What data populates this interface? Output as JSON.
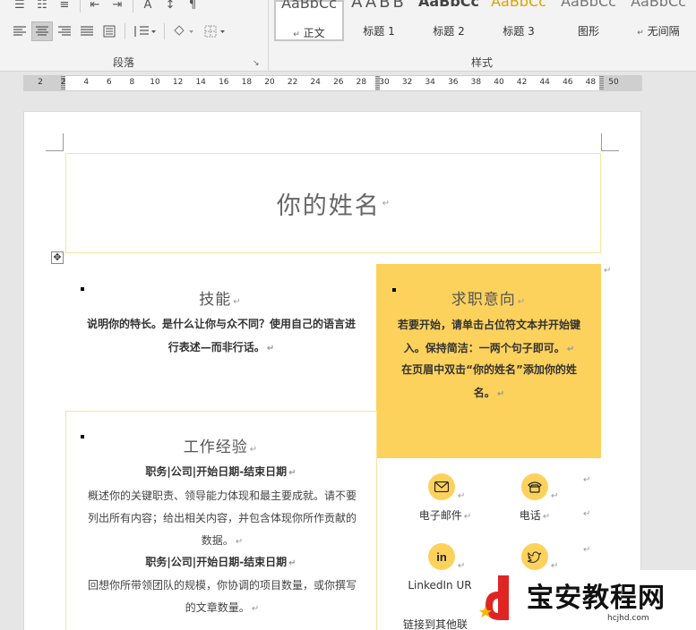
{
  "ribbon": {
    "paragraph_group_label": "段落",
    "styles_group_label": "样式",
    "styles": [
      {
        "sample": "AaBbCc",
        "name": "正文",
        "selected": true
      },
      {
        "sample": "AABB",
        "name": "标题 1"
      },
      {
        "sample": "AaBbCc",
        "name": "标题 2"
      },
      {
        "sample": "AaBbCc",
        "name": "标题 3"
      },
      {
        "sample": "AaBbCc",
        "name": "图形"
      },
      {
        "sample": "AaBbCc",
        "name": "无间隔"
      }
    ]
  },
  "ruler": {
    "ticks": [
      "2",
      "2",
      "4",
      "6",
      "8",
      "10",
      "12",
      "14",
      "16",
      "18",
      "20",
      "22",
      "24",
      "26",
      "28",
      "30",
      "32",
      "34",
      "36",
      "38",
      "40",
      "42",
      "44",
      "46",
      "48",
      "50"
    ]
  },
  "document": {
    "name": "你的姓名",
    "skills": {
      "heading": "技能",
      "text": "说明你的特长。是什么让你与众不同？使用自己的语言进行表述—而非行话。"
    },
    "objective": {
      "heading": "求职意向",
      "para1": "若要开始，请单击占位符文本并开始键入。保持简洁：一两个句子即可。",
      "para2": "在页眉中双击“你的姓名”添加你的姓名。"
    },
    "experience": {
      "heading": "工作经验",
      "job1_title": "职务|公司|开始日期-结束日期",
      "job1_desc": "概述你的关键职责、领导能力体现和最主要成就。请不要列出所有内容；给出相关内容，并包含体现你所作贡献的数据。",
      "job2_title": "职务|公司|开始日期-结束日期",
      "job2_desc": "回想你所带领团队的规模，你协调的项目数量，或你撰写的文章数量。"
    },
    "contact": {
      "email": "电子邮件",
      "phone": "电话",
      "linkedin": "LinkedIn UR",
      "other": "链接到其他联"
    }
  },
  "watermark": {
    "title": "宝安教程网",
    "url": "hcjhd.com"
  },
  "colors": {
    "accent": "#fdd25c",
    "border": "#fbe49a"
  }
}
